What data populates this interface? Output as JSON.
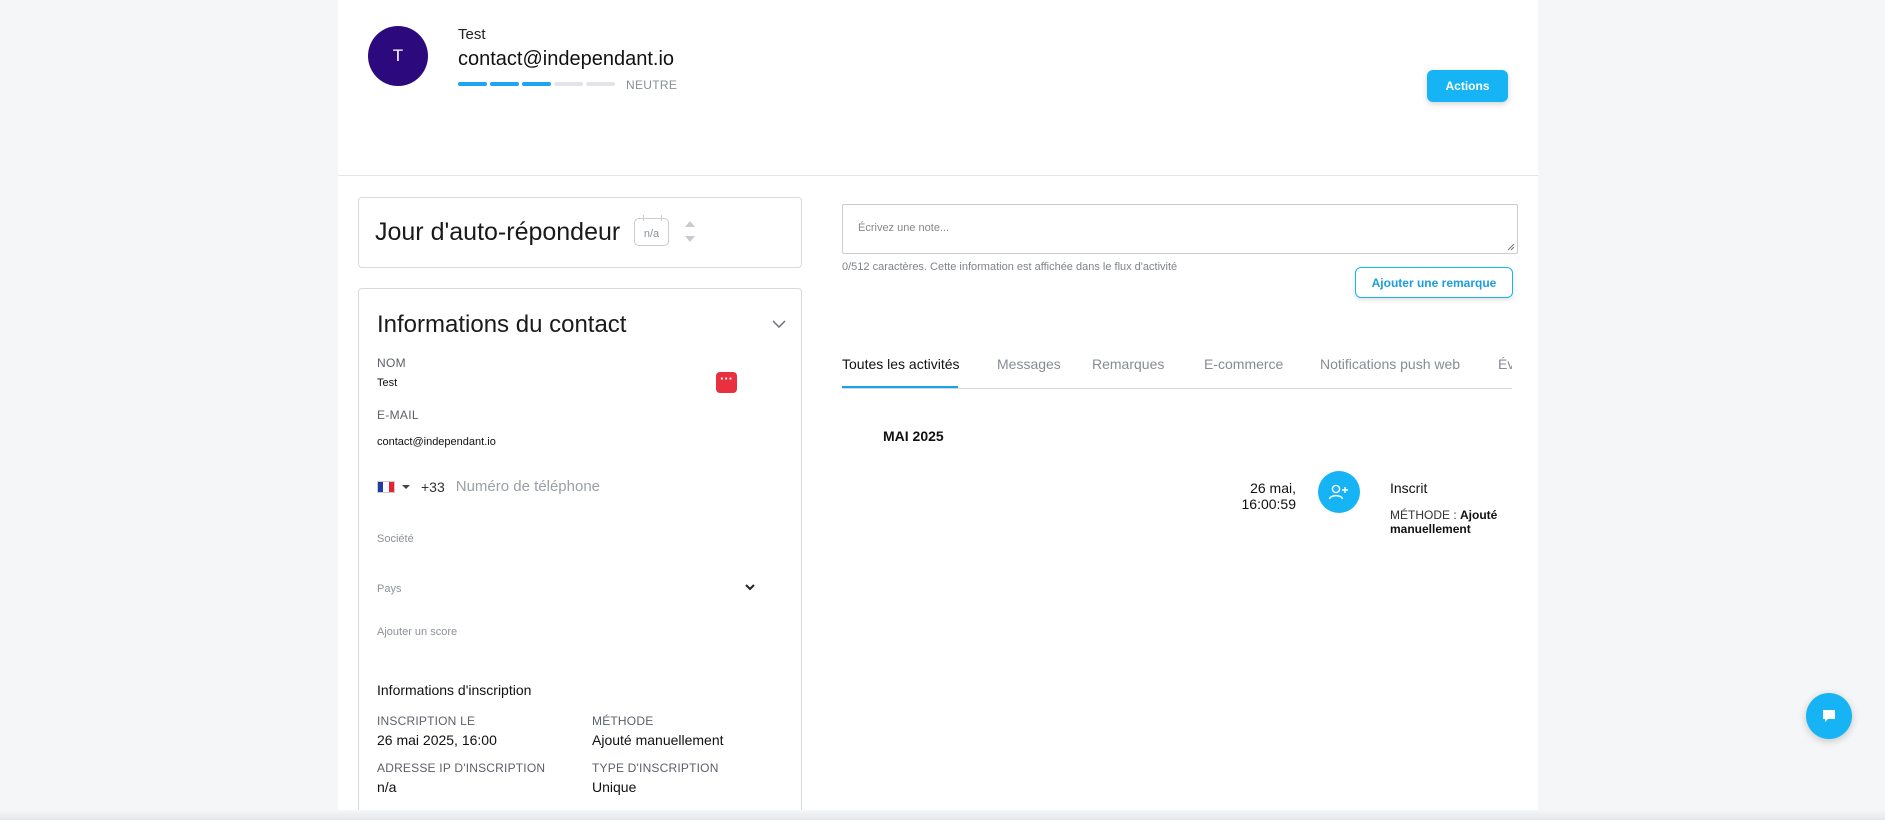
{
  "contact": {
    "initial": "T",
    "name": "Test",
    "email": "contact@independant.io",
    "score_segments_filled": 3,
    "score_segments_total": 5,
    "score_label": "NEUTRE"
  },
  "header": {
    "actions_label": "Actions"
  },
  "autoresponder": {
    "title": "Jour d'auto-répondeur",
    "value": "n/a"
  },
  "contact_info": {
    "title": "Informations du contact",
    "name_label": "NOM",
    "name_value": "Test",
    "email_label": "E-MAIL",
    "email_value": "contact@independant.io",
    "phone_dial_code": "+33",
    "phone_placeholder": "Numéro de téléphone",
    "company_placeholder": "Société",
    "country_placeholder": "Pays",
    "score_placeholder": "Ajouter un score",
    "subscription": {
      "title": "Informations d'inscription",
      "date_label": "INSCRIPTION LE",
      "date_value": "26 mai 2025, 16:00",
      "method_label": "MÉTHODE",
      "method_value": "Ajouté manuellement",
      "ip_label": "ADRESSE IP D'INSCRIPTION",
      "ip_value": "n/a",
      "type_label": "TYPE D'INSCRIPTION",
      "type_value": "Unique"
    }
  },
  "note": {
    "placeholder": "Écrivez une note...",
    "hint": "0/512 caractères. Cette information est affichée dans le flux d'activité",
    "button": "Ajouter une remarque"
  },
  "tabs": [
    "Toutes les activités",
    "Messages",
    "Remarques",
    "E-commerce",
    "Notifications push web",
    "Év"
  ],
  "activity": {
    "month": "MAI 2025",
    "items": [
      {
        "date_line1": "26 mai,",
        "date_line2": "16:00:59",
        "title": "Inscrit",
        "meta_label": "MÉTHODE :",
        "meta_value": "Ajouté manuellement",
        "icon": "add-user-icon"
      }
    ]
  },
  "colors": {
    "accent": "#16b4f4",
    "avatar": "#2c0a7e",
    "danger": "#e8303f"
  }
}
